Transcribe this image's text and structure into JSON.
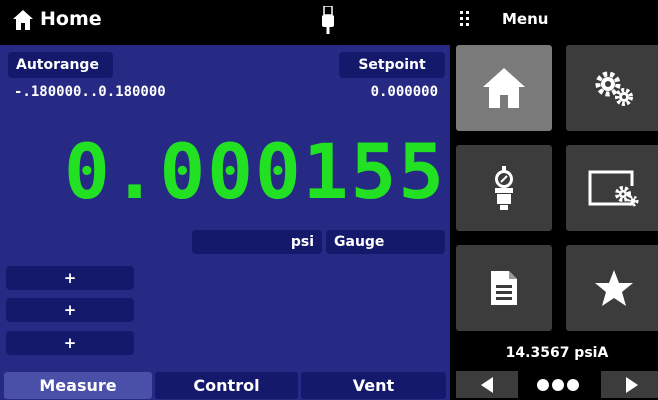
{
  "header": {
    "title": "Home",
    "home_icon": "home-icon",
    "usb_icon": "usb-icon",
    "menu_label": "Menu",
    "menu_icon": "grip-icon"
  },
  "measure": {
    "autorange_label": "Autorange",
    "range": "-.180000..0.180000",
    "setpoint_label": "Setpoint",
    "setpoint_value": "0.000000",
    "reading": "0.000155",
    "reading_color": "#22e022",
    "units": "psi",
    "mode": "Gauge",
    "aux_buttons": [
      "+",
      "+",
      "+"
    ]
  },
  "tabs": [
    {
      "label": "Measure",
      "active": true
    },
    {
      "label": "Control",
      "active": false
    },
    {
      "label": "Vent",
      "active": false
    }
  ],
  "menu": {
    "tiles": [
      {
        "icon": "home-icon",
        "active": true
      },
      {
        "icon": "settings-gears-icon",
        "active": false
      },
      {
        "icon": "pressure-transducer-icon",
        "active": false
      },
      {
        "icon": "display-settings-icon",
        "active": false
      },
      {
        "icon": "document-icon",
        "active": false
      },
      {
        "icon": "star-icon",
        "active": false
      }
    ],
    "barometer": "14.3567 psiA",
    "page_count": 3
  },
  "colors": {
    "panel": "#272a84",
    "chip": "#15196b",
    "tile": "#3c3c3c",
    "tile_active": "#7a7a7a"
  }
}
